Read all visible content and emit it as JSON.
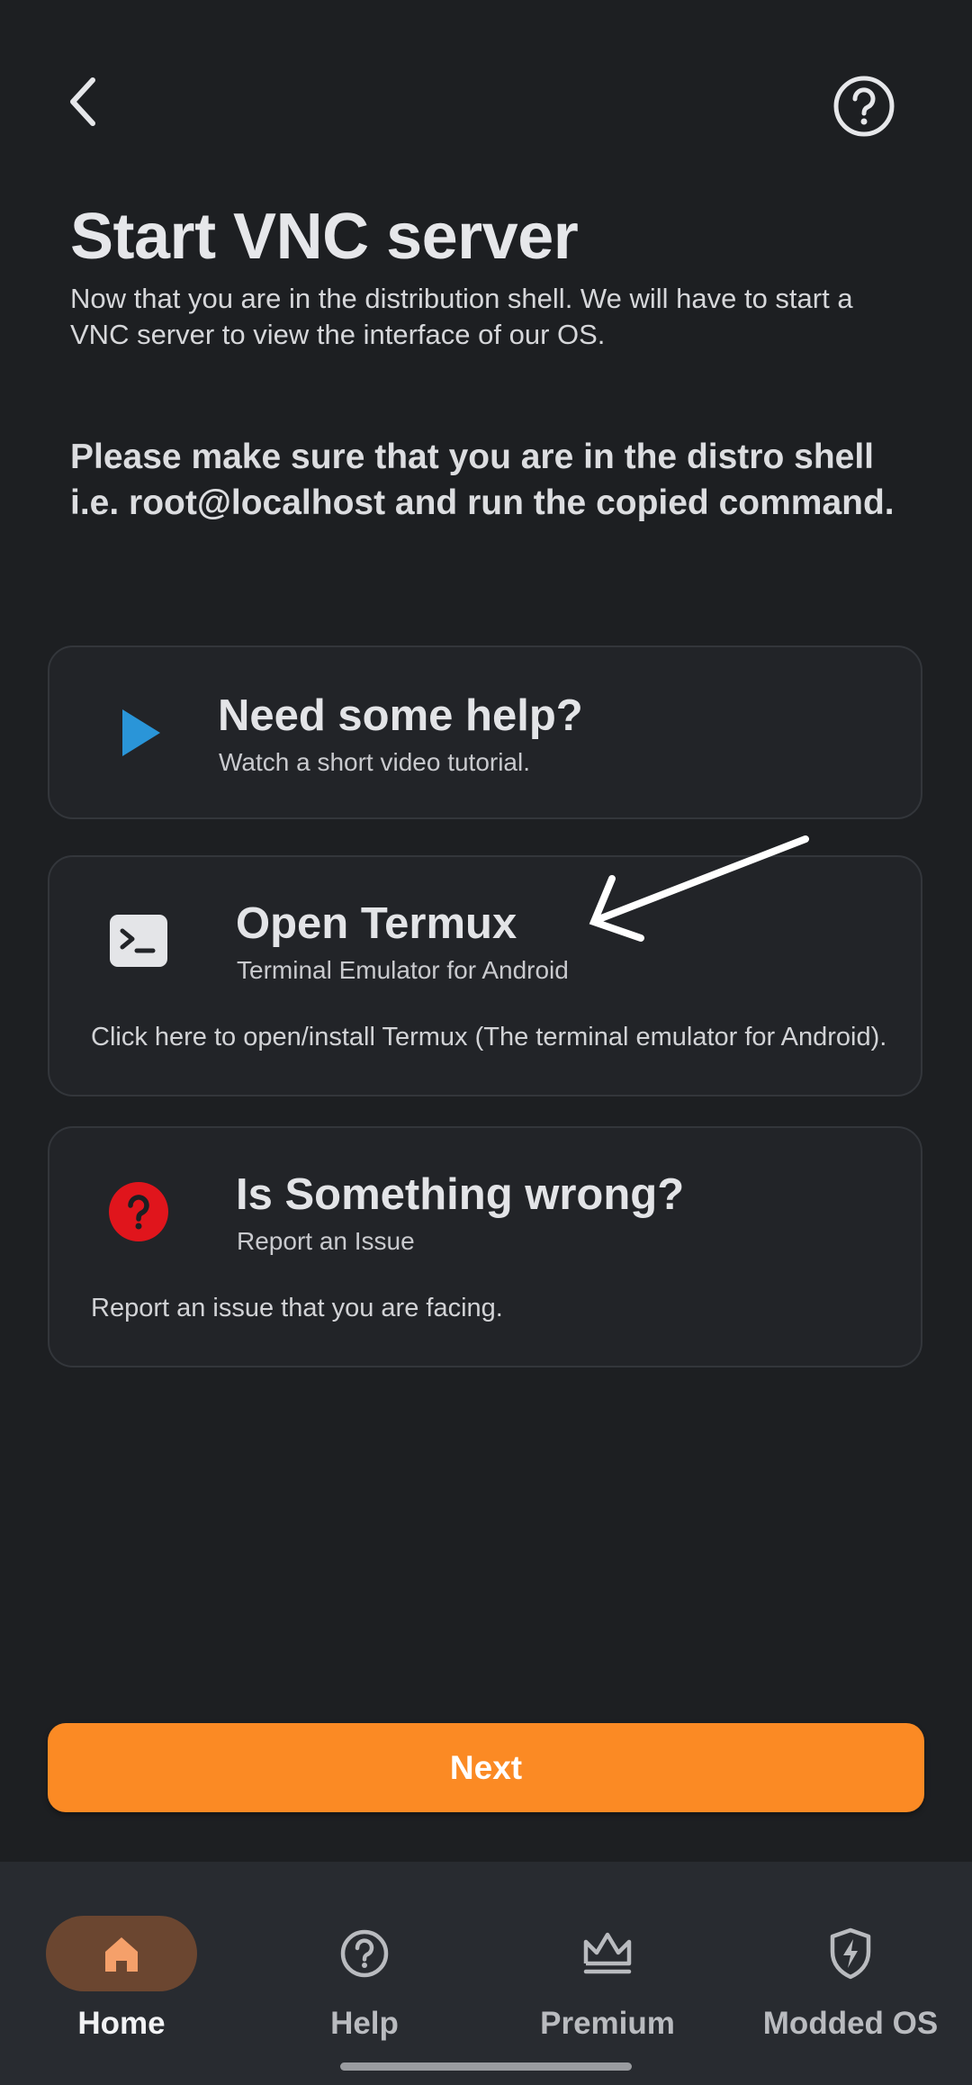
{
  "header": {
    "back_icon": "chevron-left-icon",
    "help_icon": "help-circle-icon"
  },
  "page": {
    "title": "Start VNC server",
    "description": "Now that you are in the distribution shell. We will have to start a VNC server to view the interface of our OS.",
    "instruction": "Please make sure that you are in the distro shell i.e. root@localhost and run the copied command."
  },
  "cards": {
    "help": {
      "icon": "play-icon",
      "title": "Need some help?",
      "subtitle": "Watch a short video tutorial."
    },
    "termux": {
      "icon": "terminal-icon",
      "title": "Open Termux",
      "subtitle": "Terminal Emulator for Android",
      "body": "Click here to open/install Termux (The terminal emulator for Android)."
    },
    "issue": {
      "icon": "question-circle-icon",
      "title": "Is Something wrong?",
      "subtitle": "Report an Issue",
      "body": "Report an issue that you are facing."
    }
  },
  "next_button": {
    "label": "Next"
  },
  "bottom_nav": {
    "items": [
      {
        "label": "Home",
        "icon": "home-icon",
        "active": true
      },
      {
        "label": "Help",
        "icon": "help-circle-icon",
        "active": false
      },
      {
        "label": "Premium",
        "icon": "crown-icon",
        "active": false
      },
      {
        "label": "Modded OS",
        "icon": "shield-bolt-icon",
        "active": false
      }
    ]
  },
  "colors": {
    "background": "#1d1f22",
    "card": "#222428",
    "accent": "#fb8a24",
    "play_icon": "#2a95d8",
    "issue_icon": "#e0151c",
    "nav_active_bg": "#6b4630",
    "nav_active_icon": "#f5a06a"
  }
}
